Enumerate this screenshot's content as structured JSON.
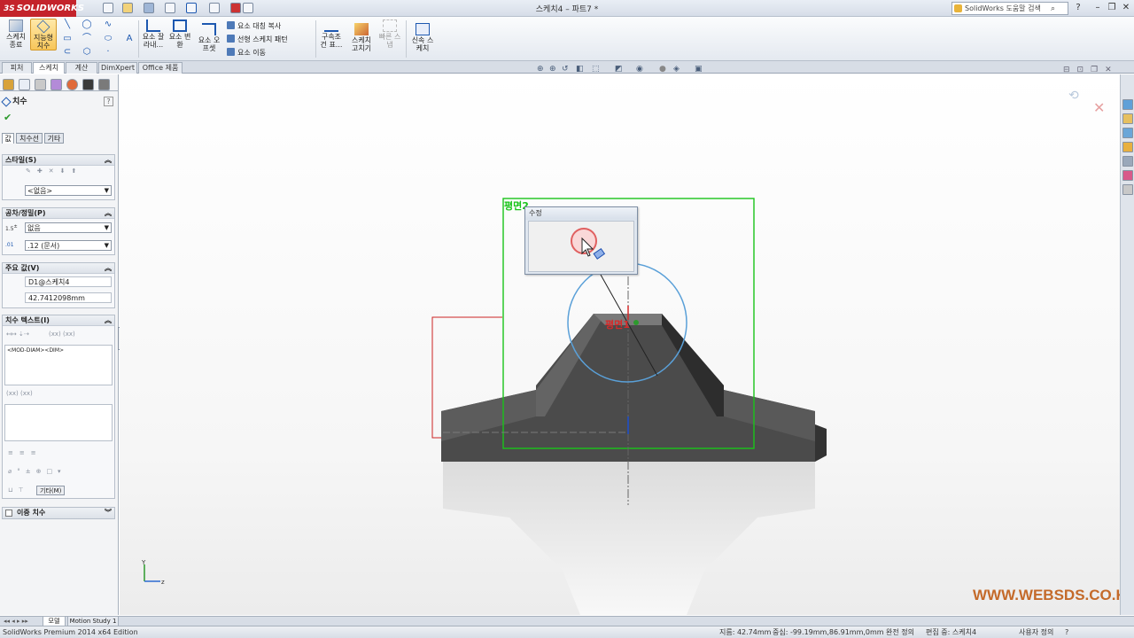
{
  "app": {
    "logo_text": "SOLIDWORKS",
    "logo_ds": "3S",
    "document_title": "스케치4 – 파트7 *",
    "help_search_placeholder": "SolidWorks 도움말 검색",
    "help_label": "?"
  },
  "ribbon": {
    "buttons": {
      "exit_sketch": "스케치\n종료",
      "smart_dimension": "지능형\n치수",
      "trim_entities": "요소 잘\n라내...",
      "convert_entities": "요소 변\n환",
      "offset_entities": "요소 오\n프셋",
      "display_relations": "구속조\n건 표...",
      "repair_sketch": "스케치\n고치기",
      "quick_snaps": "빠른 스\n냅",
      "rapid_sketch": "신속 스\n케치"
    },
    "text_commands": {
      "mirror_entities": "요소 대칭 복사",
      "linear_pattern": "선형 스케치 패턴",
      "move_entities": "요소 이동"
    }
  },
  "command_manager_tabs": [
    "피처",
    "스케치",
    "계산",
    "DimXpert",
    "Office 제품"
  ],
  "active_command_tab": "스케치",
  "property_manager": {
    "title": "치수",
    "help": "?",
    "subtabs": [
      "값",
      "치수선",
      "기타"
    ],
    "active_subtab": "값",
    "style": {
      "header": "스타일(S)",
      "selected": "<없음>"
    },
    "tolerance": {
      "header": "공차/정밀(P)",
      "tolerance_type": "없음",
      "precision": ".12 (문서)"
    },
    "primary_value": {
      "header": "주요 값(V)",
      "name": "D1@스케치4",
      "value": "42.7412098mm"
    },
    "dimension_text": {
      "header": "치수 텍스트(I)",
      "text": "<MOD-DIAM><DIM>",
      "other_button": "기타(M)"
    },
    "dual_dimension": {
      "header": "이중 치수"
    },
    "colors": {
      "accent_blue": "#1d58b0",
      "ok_green": "#2c9a2c"
    }
  },
  "viewport": {
    "modify_dialog_title": "수정",
    "plane_label_top": "평면2",
    "plane_label_bottom": "평면1",
    "watermark": "WWW.WEBSDS.CO.KR",
    "colors": {
      "part": "#4a4a4a",
      "green_plane": "#19c419",
      "red_plane": "#cc2222",
      "circle": "#5aa0d8"
    }
  },
  "bottom_tabs": [
    "모델",
    "Motion Study 1"
  ],
  "active_bottom_tab": "모델",
  "status_bar": {
    "edition": "SolidWorks Premium 2014 x64 Edition",
    "diameter": "지름: 42.74mm",
    "center": "중심: -99.19mm,86.91mm,0mm",
    "definition": "완전 정의",
    "editing": "편집 중: 스케치4",
    "custom": "사용자 정의",
    "help": "?"
  }
}
